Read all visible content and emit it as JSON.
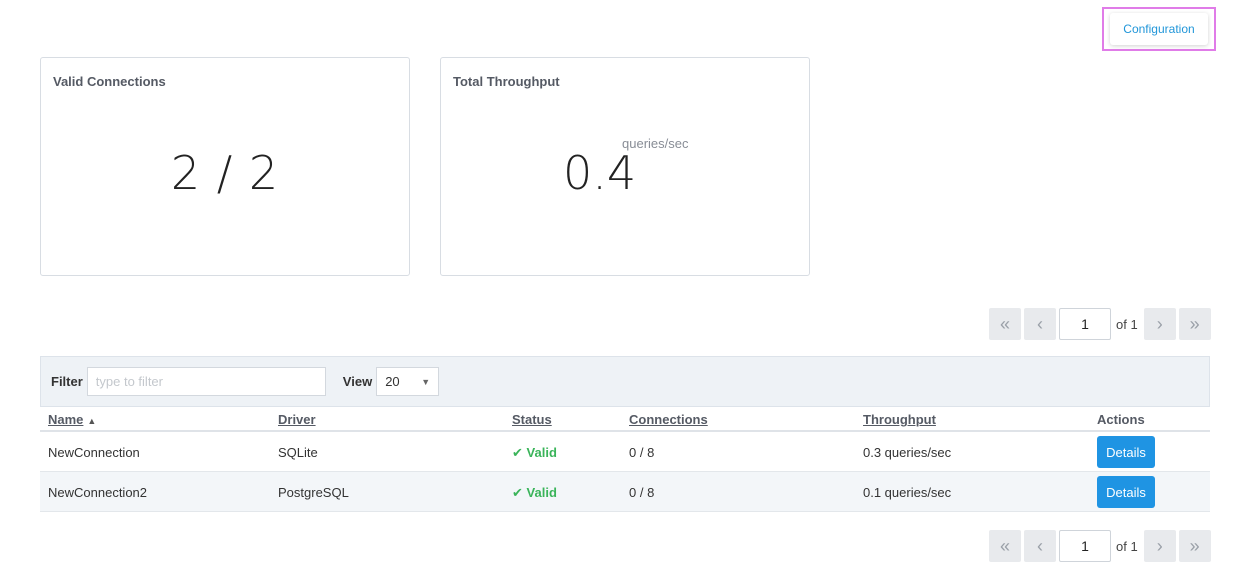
{
  "header": {
    "configuration_label": "Configuration"
  },
  "cards": {
    "valid": {
      "title": "Valid Connections",
      "value": "2 / 2"
    },
    "throughput": {
      "title": "Total Throughput",
      "value": "0.4",
      "unit": "queries/sec"
    }
  },
  "pager": {
    "first": "«",
    "prev": "‹",
    "next": "›",
    "last": "»",
    "page": "1",
    "of_text": "of 1"
  },
  "filter": {
    "label": "Filter",
    "placeholder": "type to filter",
    "value": "",
    "view_label": "View",
    "view_value": "20"
  },
  "table": {
    "headers": {
      "name": "Name",
      "driver": "Driver",
      "status": "Status",
      "connections": "Connections",
      "throughput": "Throughput",
      "actions": "Actions"
    },
    "rows": [
      {
        "name": "NewConnection",
        "driver": "SQLite",
        "status": "Valid",
        "connections": "0 / 8",
        "throughput": "0.3 queries/sec",
        "action": "Details"
      },
      {
        "name": "NewConnection2",
        "driver": "PostgreSQL",
        "status": "Valid",
        "connections": "0 / 8",
        "throughput": "0.1 queries/sec",
        "action": "Details"
      }
    ]
  },
  "colors": {
    "accent": "#1f94e3",
    "valid": "#3ab45a",
    "highlight_border": "#e07ce8"
  },
  "icons": {
    "sort": "sort-ascending-icon",
    "status": "checkmark-icon",
    "select": "chevron-down-icon"
  }
}
